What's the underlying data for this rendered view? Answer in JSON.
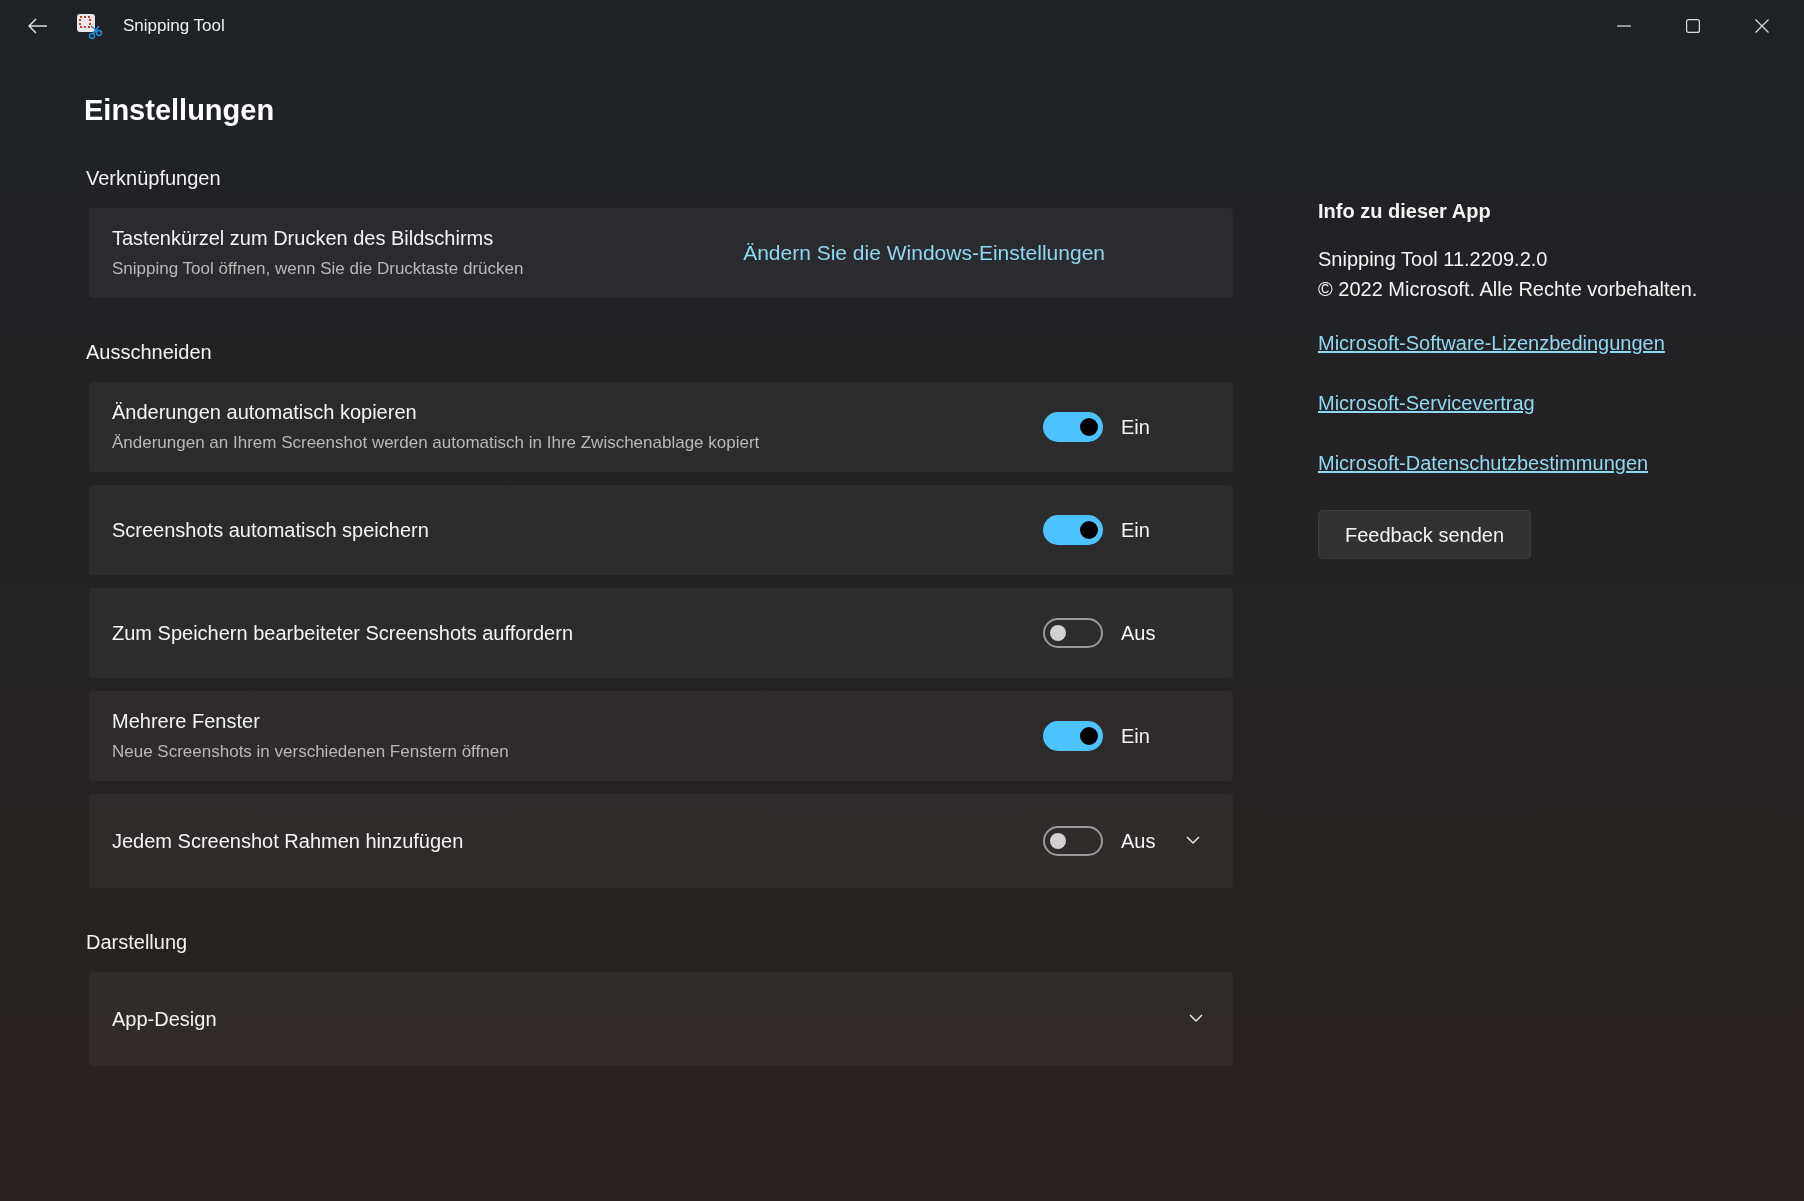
{
  "window": {
    "title": "Snipping Tool"
  },
  "page_title": "Einstellungen",
  "sections": [
    {
      "heading": "Verknüpfungen",
      "rows": [
        {
          "kind": "link",
          "title": "Tastenkürzel zum Drucken des Bildschirms",
          "subtitle": "Snipping Tool öffnen, wenn Sie die Drucktaste drücken",
          "link": "Ändern Sie die Windows-Einstellungen"
        }
      ]
    },
    {
      "heading": "Ausschneiden",
      "rows": [
        {
          "kind": "toggle",
          "title": "Änderungen automatisch kopieren",
          "subtitle": "Änderungen an Ihrem Screenshot werden automatisch in Ihre Zwischenablage kopiert",
          "on": true,
          "state_label": "Ein",
          "expandable": false
        },
        {
          "kind": "toggle",
          "title": "Screenshots automatisch speichern",
          "on": true,
          "state_label": "Ein",
          "expandable": false
        },
        {
          "kind": "toggle",
          "title": "Zum Speichern bearbeiteter Screenshots auffordern",
          "on": false,
          "state_label": "Aus",
          "expandable": false
        },
        {
          "kind": "toggle",
          "title": "Mehrere Fenster",
          "subtitle": "Neue Screenshots in verschiedenen Fenstern öffnen",
          "on": true,
          "state_label": "Ein",
          "expandable": false
        },
        {
          "kind": "toggle",
          "title": "Jedem Screenshot Rahmen hinzufügen",
          "on": false,
          "state_label": "Aus",
          "expandable": true
        }
      ]
    },
    {
      "heading": "Darstellung",
      "rows": [
        {
          "kind": "expander",
          "title": "App-Design"
        }
      ]
    }
  ],
  "about": {
    "heading": "Info zu dieser App",
    "version": "Snipping Tool 11.2209.2.0",
    "copyright": "© 2022 Microsoft. Alle Rechte vorbehalten.",
    "links": [
      "Microsoft-Software-Lizenzbedingungen",
      "Microsoft-Servicevertrag",
      "Microsoft-Datenschutzbestimmungen"
    ],
    "button": "Feedback senden"
  }
}
